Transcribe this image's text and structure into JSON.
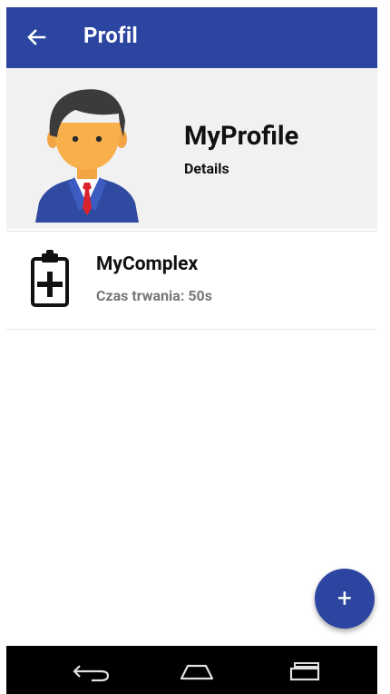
{
  "app_bar": {
    "title": "Profil",
    "background": "#2c45a0",
    "back_icon": "arrow-left-icon"
  },
  "profile": {
    "name": "MyProfile",
    "subtitle": "Details",
    "avatar_icon": "person-avatar-icon"
  },
  "items": [
    {
      "title": "MyComplex",
      "duration_label": "Czas trwania:",
      "duration_value": "50s",
      "duration_text": "Czas trwania:  50s",
      "icon": "clipboard-plus-icon"
    }
  ],
  "fab": {
    "label": "+",
    "icon": "add-icon"
  },
  "nav": {
    "back_icon": "nav-back-icon",
    "home_icon": "nav-home-icon",
    "recents_icon": "nav-recents-icon"
  }
}
